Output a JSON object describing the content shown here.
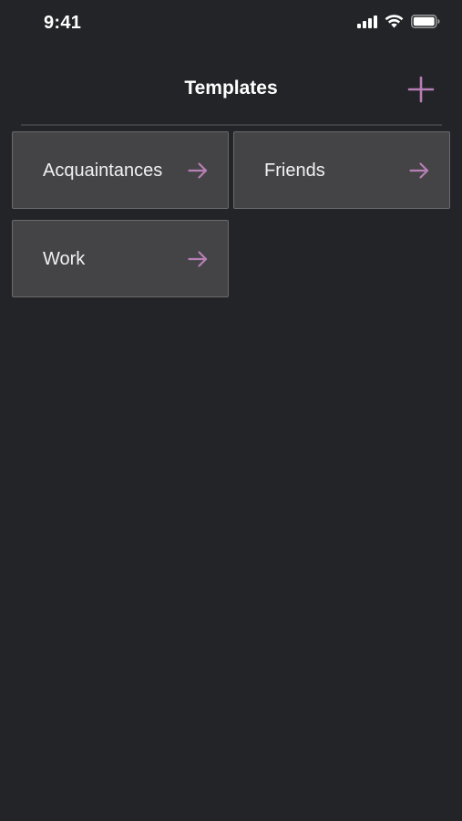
{
  "status_bar": {
    "time": "9:41"
  },
  "header": {
    "title": "Templates",
    "add_icon": "plus-icon"
  },
  "colors": {
    "background": "#232427",
    "card": "#444446",
    "accent": "#b77fb5"
  },
  "templates": [
    {
      "label": "Acquaintances",
      "icon": "arrow-right-icon"
    },
    {
      "label": "Friends",
      "icon": "arrow-right-icon"
    },
    {
      "label": "Work",
      "icon": "arrow-right-icon"
    }
  ]
}
